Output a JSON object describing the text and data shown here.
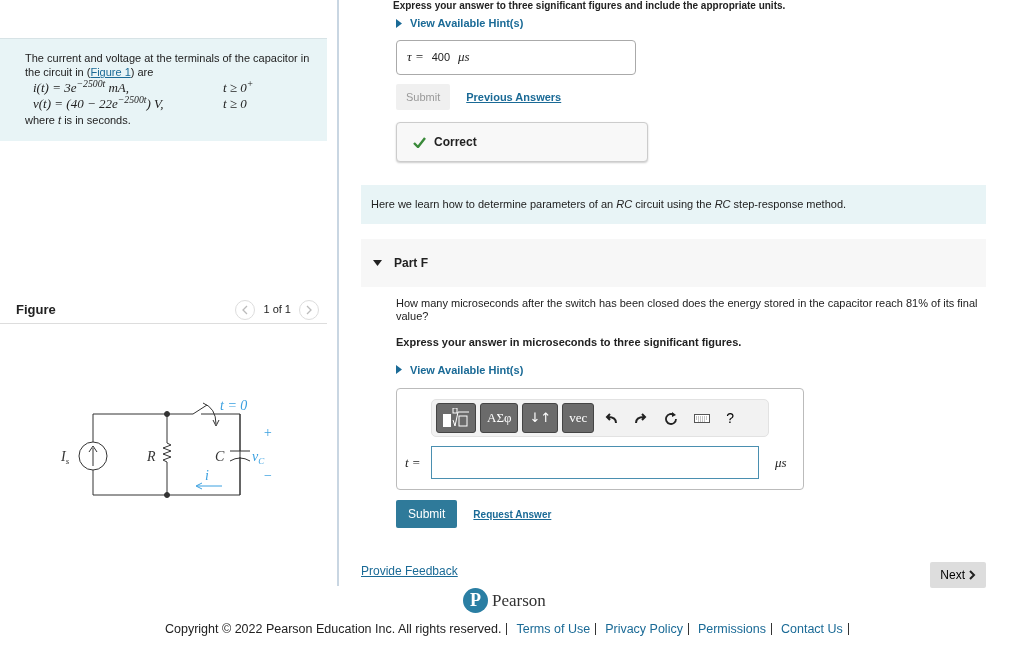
{
  "problem": {
    "intro": "The current and voltage at the terminals of the capacitor in the circuit in (",
    "figure_link": "Figure 1",
    "intro_end": ") are",
    "equations": [
      {
        "formula": "i(t) = 3e$^{−2500t}$ mA,",
        "condition": "t ≥ 0$^{+}$"
      },
      {
        "formula": "v(t) = (40 − 22e$^{−2500t}$) V,",
        "condition": "t ≥ 0"
      }
    ],
    "note": "where *t* is in seconds."
  },
  "figure": {
    "title": "Figure",
    "pager": "1 of 1",
    "labels": {
      "source": "I$_{s}$",
      "resistor": "R",
      "capacitor": "C",
      "voltage": "v$_{C}$",
      "switch": "t = 0",
      "plus": "+",
      "minus": "−",
      "current": "i"
    }
  },
  "previous_part": {
    "instruction": "Express your answer to three significant figures and include the appropriate units.",
    "hint_link": "View Available Hint(s)",
    "answer": {
      "label": "τ =",
      "value": "400",
      "unit": "μs"
    },
    "submit": {
      "label": "Submit",
      "disabled": true
    },
    "previous_answers_link": "Previous Answers",
    "feedback": {
      "text": "Correct",
      "correct": true
    }
  },
  "info": "Here we learn how to determine parameters of an *RC* circuit using the *RC* step-response method.",
  "part": {
    "title": "Part F",
    "expanded": true,
    "question": "How many microseconds after the switch has been closed does the energy stored in the capacitor reach 81% of its final value?",
    "instruction": "Express your answer in microseconds to three significant figures.",
    "hint_link": "View Available Hint(s)",
    "toolbar": [
      {
        "kind": "templates"
      },
      {
        "kind": "dark",
        "label": "ΑΣφ"
      },
      {
        "kind": "dark",
        "label": "↓↑"
      },
      {
        "kind": "dark",
        "label": "vec"
      },
      {
        "kind": "undo"
      },
      {
        "kind": "redo"
      },
      {
        "kind": "reset"
      },
      {
        "kind": "keyboard"
      },
      {
        "kind": "plain",
        "label": "?"
      }
    ],
    "answer": {
      "label": "t =",
      "unit": "μs"
    },
    "submit": {
      "label": "Submit",
      "disabled": false
    },
    "request_link": "Request Answer"
  },
  "feedback_link": "Provide Feedback",
  "next_button": "Next",
  "brand": {
    "mark": "P",
    "name": "Pearson"
  },
  "footer": {
    "copyright": "Copyright © 2022 Pearson Education Inc. All rights reserved.",
    "links": [
      "Terms of Use",
      "Privacy Policy",
      "Permissions",
      "Contact Us"
    ]
  }
}
